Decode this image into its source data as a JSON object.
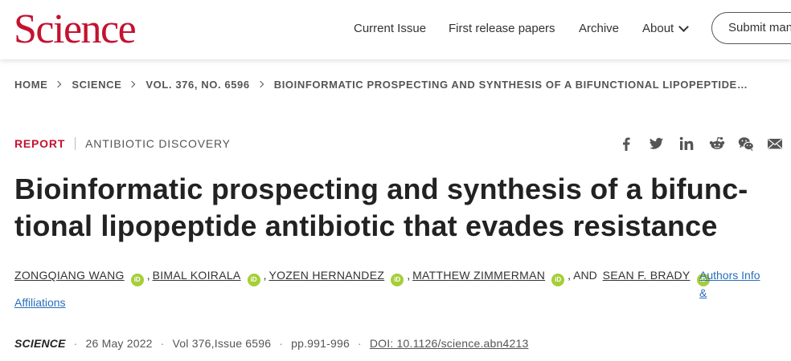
{
  "header": {
    "logo": "Science",
    "nav": [
      {
        "label": "Current Issue"
      },
      {
        "label": "First release papers"
      },
      {
        "label": "Archive"
      },
      {
        "label": "About"
      }
    ],
    "submit_label": "Submit manuscript"
  },
  "breadcrumb": [
    "HOME",
    "SCIENCE",
    "VOL. 376, NO. 6596",
    "BIOINFORMATIC PROSPECTING AND SYNTHESIS OF A BIFUNCTIONAL LIPOPEPTIDE…"
  ],
  "article": {
    "type": "REPORT",
    "topic": "ANTIBIOTIC DISCOVERY",
    "title_line1": "Bioinformatic prospecting and synthesis of a bifunc-",
    "title_line2": "tional lipopeptide antibiotic that evades resistance",
    "authors": [
      "ZONGQIANG WANG",
      "BIMAL KOIRALA",
      "YOZEN HERNANDEZ",
      "MATTHEW ZIMMERMAN",
      "SEAN F. BRADY"
    ],
    "orcid_label": "iD",
    "and_label": ", AND",
    "authors_info_label": "Authors Info &",
    "affiliations_label": "Affiliations",
    "journal": "SCIENCE",
    "date": "26 May 2022",
    "volume": "Vol 376,Issue 6596",
    "pages": "pp.991-996",
    "doi": "DOI: 10.1126/science.abn4213"
  },
  "share_icons": [
    "facebook-icon",
    "twitter-icon",
    "linkedin-icon",
    "reddit-icon",
    "wechat-icon",
    "email-icon"
  ],
  "colors": {
    "brand": "#c4122f",
    "link": "#2a6ebb",
    "orcid": "#a6ce39"
  }
}
